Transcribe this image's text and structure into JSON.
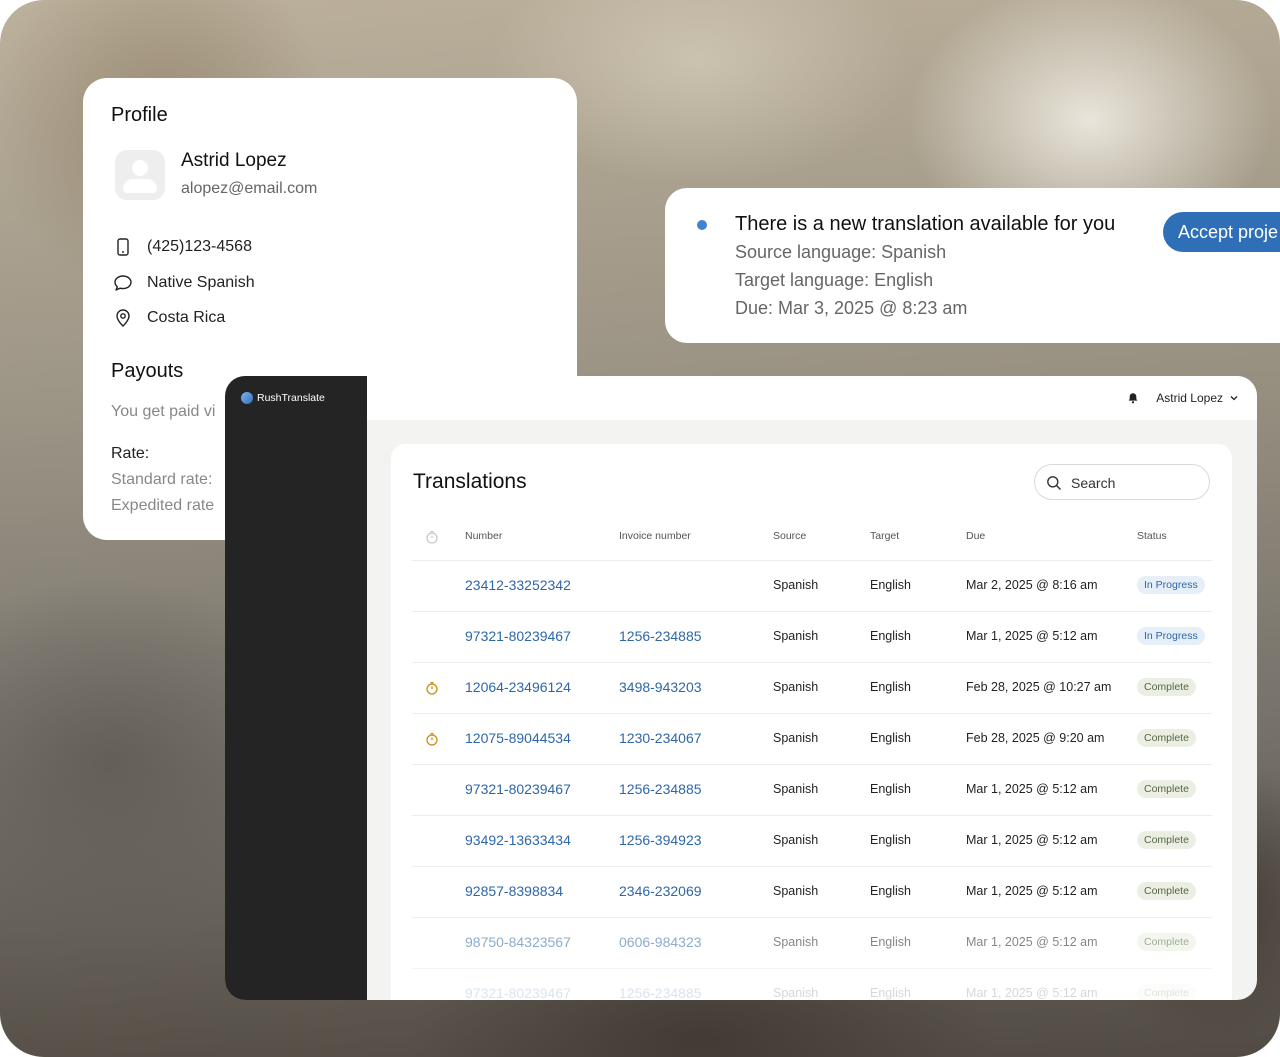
{
  "colors": {
    "accent": "#2f6fb8",
    "link": "#2e67a8",
    "sidebar": "#242424",
    "notif_dot": "#3f83d1"
  },
  "profile": {
    "title": "Profile",
    "name": "Astrid Lopez",
    "email": "alopez@email.com",
    "phone": "(425)123-4568",
    "language": "Native Spanish",
    "location": "Costa Rica",
    "payouts_title": "Payouts",
    "payouts_text": "You get paid vi",
    "rate_label": "Rate:",
    "standard_rate": "Standard rate:",
    "expedited_rate": "Expedited rate"
  },
  "notification": {
    "title": "There is a new translation available for you",
    "source": "Source language: Spanish",
    "target": "Target language: English",
    "due": "Due: Mar 3, 2025 @ 8:23 am",
    "accept_label": "Accept proje"
  },
  "app": {
    "brand": "RushTranslate",
    "user": "Astrid Lopez",
    "page_title": "Translations",
    "search_placeholder": "Search",
    "columns": {
      "number": "Number",
      "invoice": "Invoice number",
      "source": "Source",
      "target": "Target",
      "due": "Due",
      "status": "Status"
    },
    "rows": [
      {
        "timer": false,
        "number": "23412-33252342",
        "invoice": "",
        "source": "Spanish",
        "target": "English",
        "due": "Mar 2, 2025 @ 8:16 am",
        "status": "In Progress",
        "kind": "progress"
      },
      {
        "timer": false,
        "number": "97321-80239467",
        "invoice": "1256-234885",
        "source": "Spanish",
        "target": "English",
        "due": "Mar 1, 2025 @ 5:12 am",
        "status": "In Progress",
        "kind": "progress"
      },
      {
        "timer": true,
        "number": "12064-23496124",
        "invoice": "3498-943203",
        "source": "Spanish",
        "target": "English",
        "due": "Feb 28, 2025 @ 10:27 am",
        "status": "Complete",
        "kind": "complete"
      },
      {
        "timer": true,
        "number": "12075-89044534",
        "invoice": "1230-234067",
        "source": "Spanish",
        "target": "English",
        "due": "Feb 28, 2025 @ 9:20 am",
        "status": "Complete",
        "kind": "complete"
      },
      {
        "timer": false,
        "number": "97321-80239467",
        "invoice": "1256-234885",
        "source": "Spanish",
        "target": "English",
        "due": "Mar 1, 2025 @ 5:12 am",
        "status": "Complete",
        "kind": "complete"
      },
      {
        "timer": false,
        "number": "93492-13633434",
        "invoice": "1256-394923",
        "source": "Spanish",
        "target": "English",
        "due": "Mar 1, 2025 @ 5:12 am",
        "status": "Complete",
        "kind": "complete"
      },
      {
        "timer": false,
        "number": "92857-8398834",
        "invoice": "2346-232069",
        "source": "Spanish",
        "target": "English",
        "due": "Mar 1, 2025 @ 5:12 am",
        "status": "Complete",
        "kind": "complete"
      },
      {
        "timer": false,
        "number": "98750-84323567",
        "invoice": "0606-984323",
        "source": "Spanish",
        "target": "English",
        "due": "Mar 1, 2025 @ 5:12 am",
        "status": "Complete",
        "kind": "complete"
      },
      {
        "timer": false,
        "number": "97321-80239467",
        "invoice": "1256-234885",
        "source": "Spanish",
        "target": "English",
        "due": "Mar 1, 2025 @ 5:12 am",
        "status": "Complete",
        "kind": "complete"
      }
    ]
  }
}
